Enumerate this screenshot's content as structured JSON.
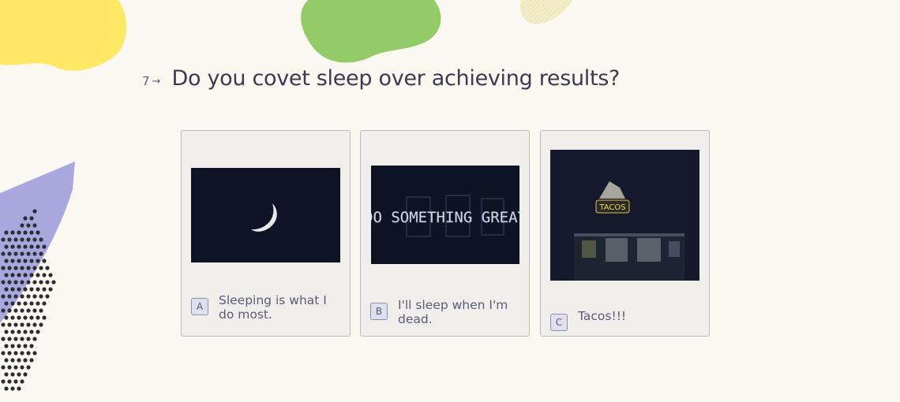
{
  "question": {
    "number": "7",
    "arrow": "→",
    "text": "Do you covet sleep over achieving results?"
  },
  "options": [
    {
      "key": "A",
      "label": "Sleeping is what I do most.",
      "image": "crescent-moon-night"
    },
    {
      "key": "B",
      "label": "I'll sleep when I'm dead.",
      "image": "neon-sign",
      "sign_text": "DO SOMETHING GREAT"
    },
    {
      "key": "C",
      "label": "Tacos!!!",
      "image": "taco-shop-night",
      "sign_text": "TACOS"
    }
  ],
  "colors": {
    "background": "#fbf8f1",
    "card": "#efeeeb",
    "card_border": "#b9b9c3",
    "key_bg": "#dfe0ec",
    "blob_yellow": "#ffe866",
    "blob_green": "#92cb67",
    "blob_purple": "#a8a8de"
  }
}
